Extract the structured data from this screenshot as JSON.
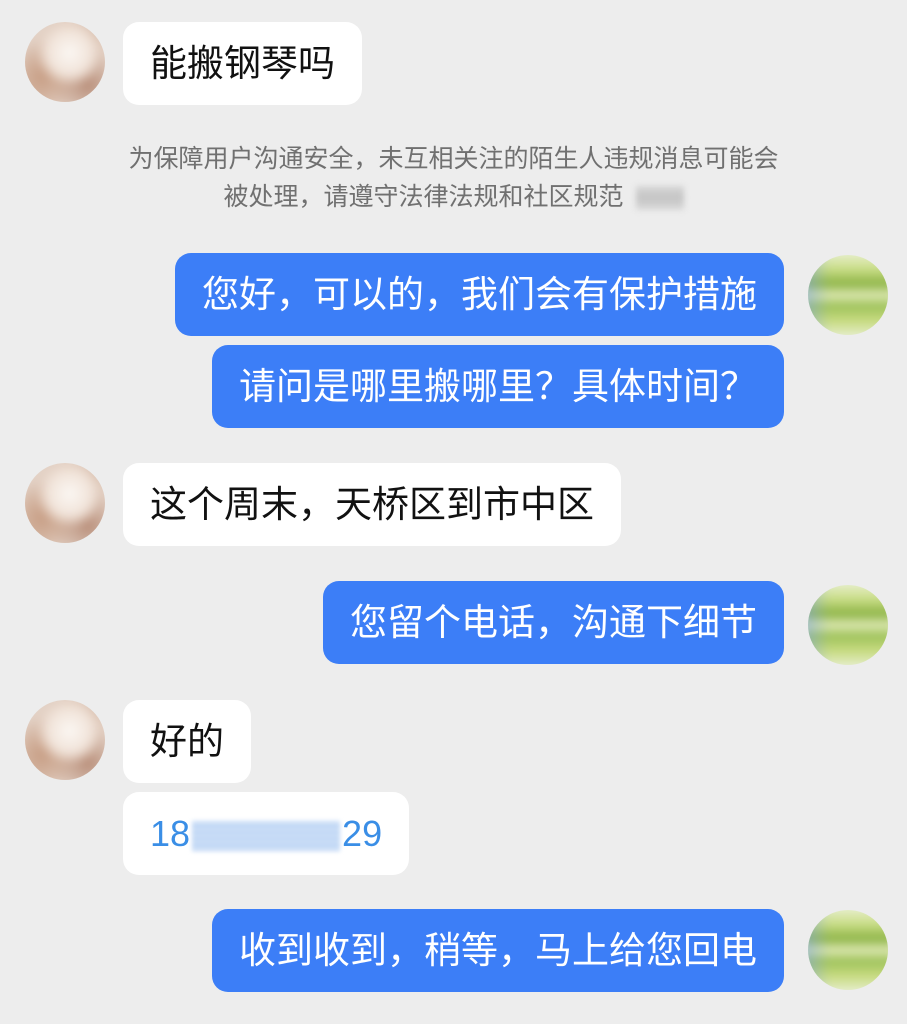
{
  "colors": {
    "background": "#ededed",
    "outgoing_bubble": "#3c7ef7",
    "incoming_bubble": "#ffffff",
    "outgoing_text": "#ffffff",
    "incoming_text": "#111111",
    "notice_text": "#707070",
    "phone_text": "#3a8ee6"
  },
  "messages": [
    {
      "side": "incoming",
      "text": "能搬钢琴吗"
    },
    {
      "side": "outgoing",
      "text": "您好，可以的，我们会有保护措施"
    },
    {
      "side": "outgoing",
      "text": "请问是哪里搬哪里？具体时间？"
    },
    {
      "side": "incoming",
      "text": "这个周末，天桥区到市中区"
    },
    {
      "side": "outgoing",
      "text": "您留个电话，沟通下细节"
    },
    {
      "side": "incoming",
      "text": "好的"
    },
    {
      "side": "outgoing",
      "text": "收到收到，稍等，马上给您回电"
    }
  ],
  "notice": {
    "line1": "为保障用户沟通安全，未互相关注的陌生人违规消息可能会",
    "line2": "被处理，请遵守法律法规和社区规范"
  },
  "phone_message": {
    "prefix": "18",
    "suffix": "29"
  }
}
